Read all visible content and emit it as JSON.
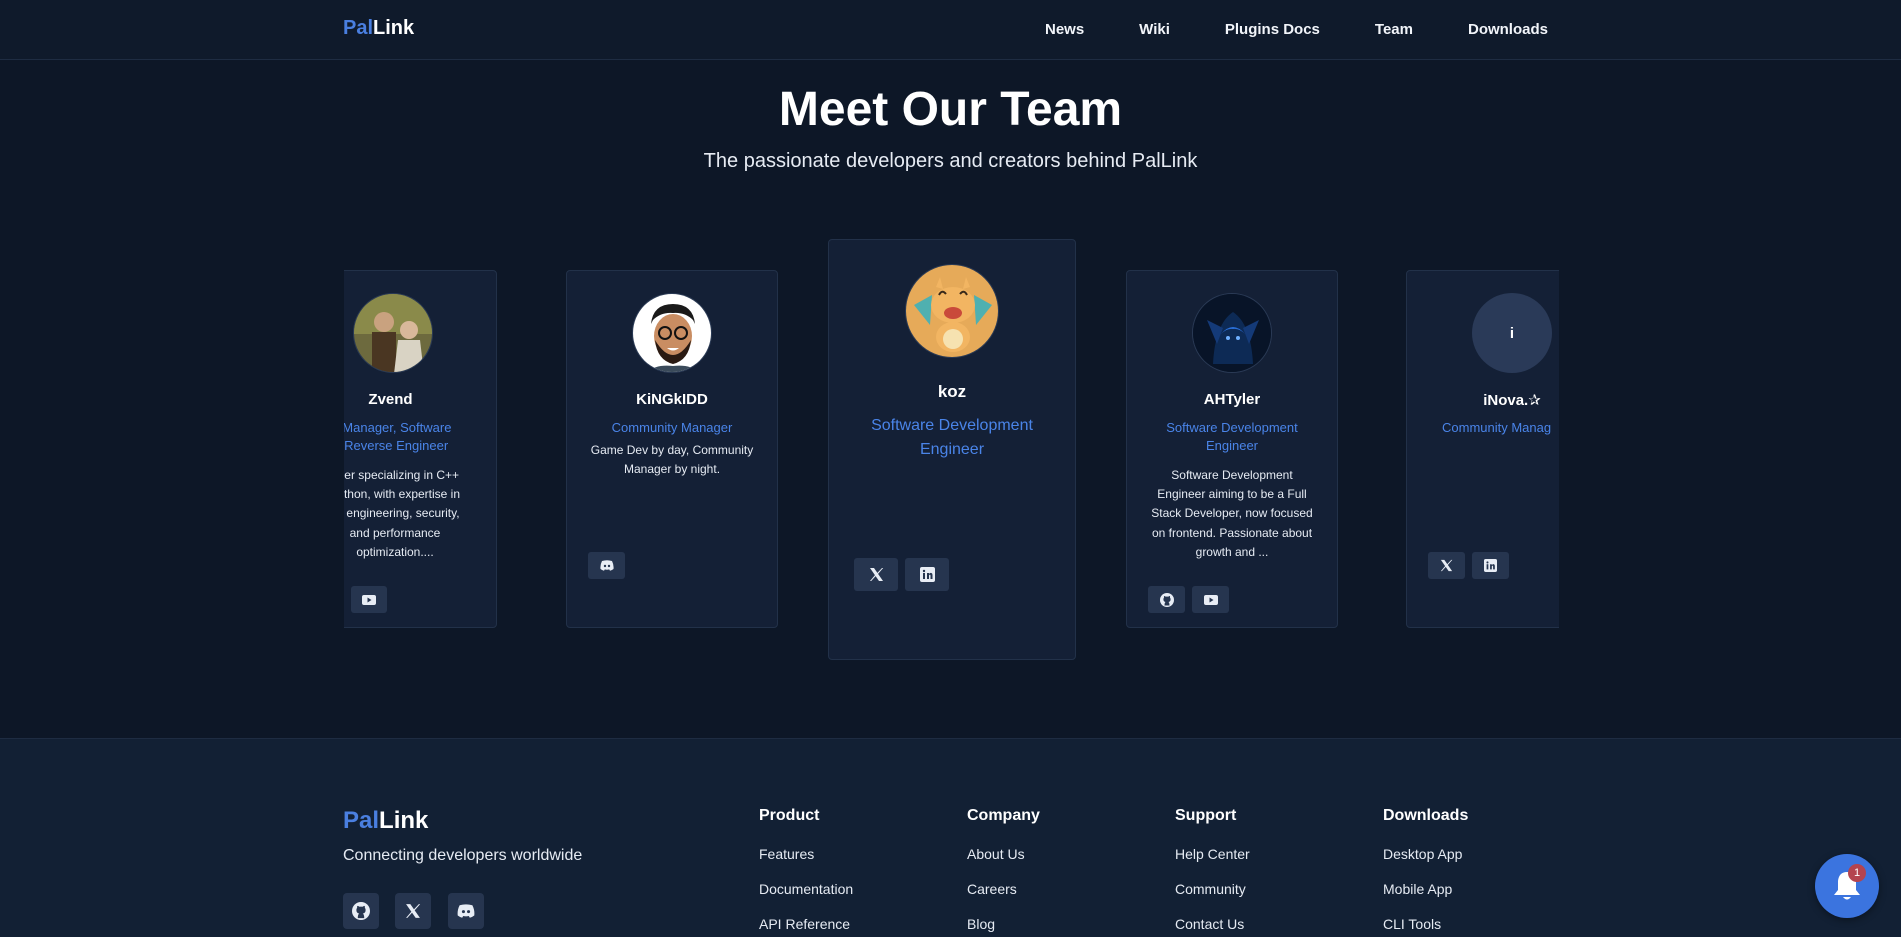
{
  "nav": {
    "logo_pal": "Pal",
    "logo_link": "Link",
    "links": [
      "News",
      "Wiki",
      "Plugins Docs",
      "Team",
      "Downloads"
    ]
  },
  "hero": {
    "title": "Meet Our Team",
    "subtitle": "The passionate developers and creators behind PalLink"
  },
  "team": [
    {
      "name": "Zvend",
      "role_line1": "ct Manager, Software",
      "role_line2": "& Reverse Engineer",
      "bio": [
        "oper specializing in C++",
        "Python, with expertise in",
        "se engineering, security,",
        "and performance",
        "optimization...."
      ],
      "socials": [
        "youtube-icon"
      ]
    },
    {
      "name": "KiNGkIDD",
      "role_line1": "Community Manager",
      "bio": [
        "Game Dev by day, Community",
        "Manager by night."
      ],
      "socials": [
        "discord-icon"
      ]
    },
    {
      "name": "koz",
      "role_line1": "Software Development",
      "role_line2": "Engineer",
      "socials": [
        "x-icon",
        "linkedin-icon"
      ]
    },
    {
      "name": "AHTyler",
      "role_line1": "Software Development",
      "role_line2": "Engineer",
      "bio": [
        "Software Development",
        "Engineer aiming to be a Full",
        "Stack Developer, now focused",
        "on frontend. Passionate about",
        "growth and ..."
      ],
      "socials": [
        "github-icon",
        "youtube-icon"
      ]
    },
    {
      "name": "iNova.✰",
      "avatar_letter": "i",
      "role_line1": "Community Manag",
      "socials": [
        "x-icon",
        "linkedin-icon"
      ]
    }
  ],
  "footer": {
    "logo_pal": "Pal",
    "logo_link": "Link",
    "tagline": "Connecting developers worldwide",
    "socials": [
      "github-icon",
      "x-icon",
      "discord-icon"
    ],
    "columns": [
      {
        "title": "Product",
        "links": [
          "Features",
          "Documentation",
          "API Reference"
        ]
      },
      {
        "title": "Company",
        "links": [
          "About Us",
          "Careers",
          "Blog"
        ]
      },
      {
        "title": "Support",
        "links": [
          "Help Center",
          "Community",
          "Contact Us"
        ]
      },
      {
        "title": "Downloads",
        "links": [
          "Desktop App",
          "Mobile App",
          "CLI Tools"
        ]
      }
    ]
  },
  "notification": {
    "count": "1"
  },
  "colors": {
    "accent": "#4a7fe0",
    "background": "#0d1727",
    "card": "#142036",
    "badge": "#b4444f"
  }
}
